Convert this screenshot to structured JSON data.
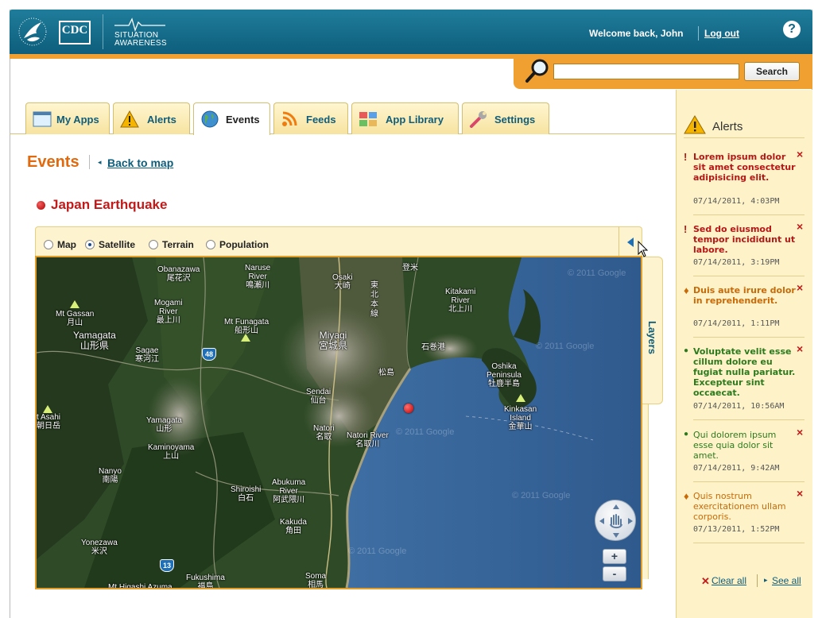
{
  "header": {
    "logo_text": "CDC",
    "product_line1": "SITUATION",
    "product_line2": "AWARENESS",
    "welcome": "Welcome back, John",
    "logout": "Log out",
    "help": "?"
  },
  "search": {
    "value": "",
    "placeholder": "",
    "button": "Search"
  },
  "tabs": [
    {
      "label": "My Apps",
      "icon": "window-icon"
    },
    {
      "label": "Alerts",
      "icon": "warning-icon"
    },
    {
      "label": "Events",
      "icon": "globe-icon",
      "active": true
    },
    {
      "label": "Feeds",
      "icon": "rss-icon"
    },
    {
      "label": "App Library",
      "icon": "grid-icon"
    },
    {
      "label": "Settings",
      "icon": "wrench-icon"
    }
  ],
  "page": {
    "title": "Events",
    "back_link": "Back to map",
    "event_title": "Japan Earthquake"
  },
  "map": {
    "modes": [
      "Map",
      "Satellite",
      "Terrain",
      "Population"
    ],
    "selected_mode": "Satellite",
    "layers_label": "Layers",
    "watermark": "© 2011 Google",
    "zoom_in": "+",
    "zoom_out": "-",
    "places": {
      "obanazawa": "Obanazawa",
      "obanazawa_jp": "尾花沢",
      "naruse": "Naruse",
      "naruse2": "River",
      "naruse_jp": "鳴瀬川",
      "osaki": "Osaki",
      "osaki_jp": "大崎",
      "tome_jp": "登米",
      "tohoku_jp": "東北本線",
      "kitakami": "Kitakami",
      "kitakami2": "River",
      "kitakami_jp": "北上川",
      "mogami": "Mogami",
      "mogami2": "River",
      "mogami_jp": "最上川",
      "gassan": "Mt Gassan",
      "gassan_jp": "月山",
      "funagata": "Mt Funagata",
      "funagata_jp": "船形山",
      "miyagi": "Miyagi",
      "miyagi_jp": "宮城県",
      "yamagata_pref": "Yamagata",
      "yamagata_pref_jp": "山形県",
      "sagae": "Sagae",
      "sagae_jp": "寒河江",
      "ishinomaki_jp": "石巻港",
      "matsushima_jp": "松島",
      "oshika": "Oshika",
      "oshika2": "Peninsula",
      "oshika_jp": "牡鹿半島",
      "sendai": "Sendai",
      "sendai_jp": "仙台",
      "asahi": "t Asahi",
      "asahi_jp": "朝日岳",
      "yamagata": "Yamagata",
      "yamagata_jp": "山形",
      "kinkasan": "Kinkasan",
      "kinkasan2": "Island",
      "kinkasan_jp": "金華山",
      "natori": "Natori",
      "natori_jp": "名取",
      "natori_river": "Natori River",
      "natori_river_jp": "名取川",
      "kaminoyama": "Kaminoyama",
      "kaminoyama_jp": "上山",
      "nanyo": "Nanyo",
      "nanyo_jp": "南陽",
      "shiroishi": "Shiroishi",
      "shiroishi_jp": "白石",
      "abukuma": "Abukuma",
      "abukuma2": "River",
      "abukuma_jp": "阿武隈川",
      "kakuda": "Kakuda",
      "kakuda_jp": "角田",
      "yonezawa": "Yonezawa",
      "yonezawa_jp": "米沢",
      "fukushima": "Fukushima",
      "fukushima_jp": "福島",
      "higashi": "Mt Higashi Azuma",
      "soma": "Soma",
      "soma_jp": "相馬",
      "route48": "48",
      "route13": "13"
    }
  },
  "sidebar": {
    "title": "Alerts",
    "items": [
      {
        "marker": "!",
        "text": "Lorem ipsum dolor sit amet consectetur adipisicing elit.",
        "date": "07/14/2011, 4:03PM",
        "severity": "critical"
      },
      {
        "marker": "!",
        "text": "Sed do eiusmod tempor incididunt ut labore.",
        "date": "07/14/2011, 3:19PM",
        "severity": "critical"
      },
      {
        "marker": "♦",
        "text": "Duis aute irure dolor in reprehenderit.",
        "date": "07/14/2011, 1:11PM",
        "severity": "warning"
      },
      {
        "marker": "●",
        "text": "Voluptate velit esse cillum dolore eu fugiat nulla pariatur. Excepteur sint occaecat.",
        "date": "07/14/2011, 10:56AM",
        "severity": "info"
      },
      {
        "marker": "●",
        "text": "Qui dolorem ipsum esse quia dolor sit amet.",
        "date": "07/14/2011, 9:42AM",
        "severity": "info-read"
      },
      {
        "marker": "♦",
        "text": "Quis nostrum exercitationem ullam corporis.",
        "date": "07/13/2011, 1:52PM",
        "severity": "warning-read"
      }
    ],
    "clear_all": "Clear all",
    "see_all": "See all"
  },
  "colors": {
    "header": "#1f7d9b",
    "accent": "#f0a030",
    "critical": "#b51717",
    "warning": "#c86a08",
    "info": "#2d7a1e"
  }
}
